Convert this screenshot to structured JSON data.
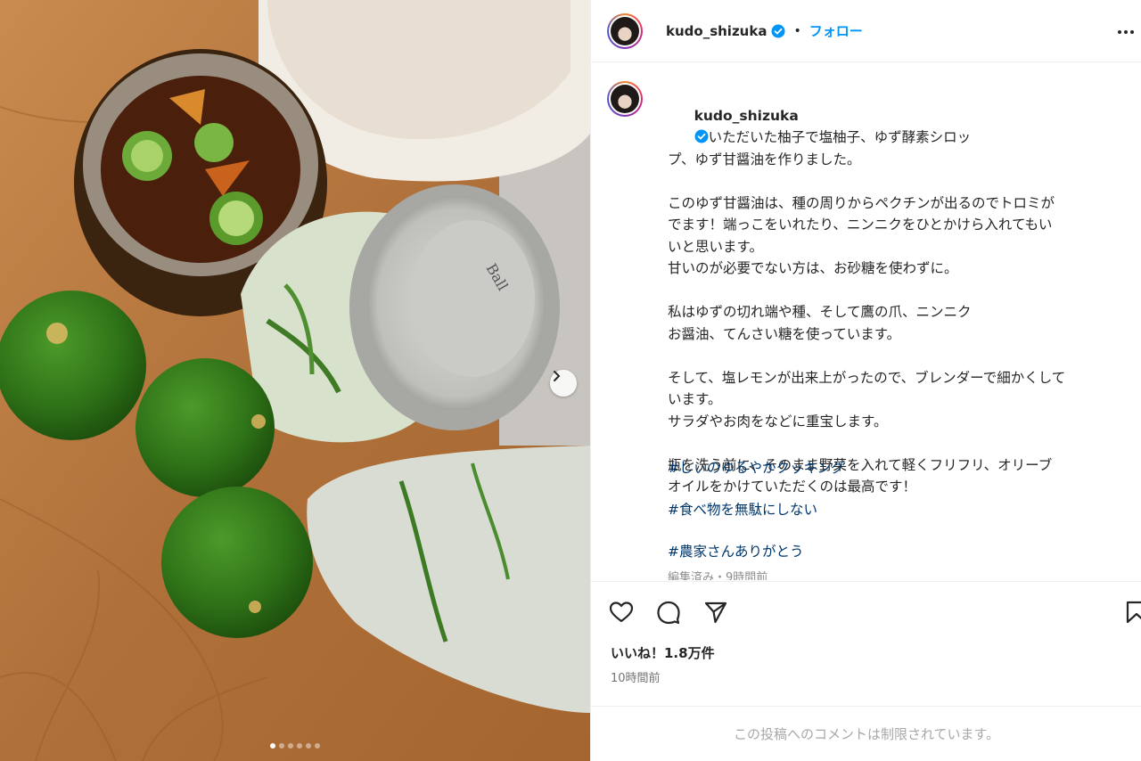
{
  "post": {
    "username": "kudo_shizuka",
    "verified_icon": "verified-badge-icon",
    "separator": "•",
    "follow_label": "フォロー",
    "caption_intro": "いただいた柚子で塩柚子、ゆず酵素シロッ\nプ、ゆず甘醤油を作りました。",
    "caption_body": "このゆず甘醤油は、種の周りからペクチンが出るのでトロミが\nでます！端っこをいれたり、ニンニクをひとかけら入れてもい\nいと思います。\n甘いのが必要でない方は、お砂糖を使わずに。\n\n私はゆずの切れ端や種、そして鷹の爪、ニンニク\nお醤油、てんさい糖を使っています。\n\nそして、塩レモンが出来上がったので、ブレンダーで細かくして\nいます。\nサラダやお肉をなどに重宝します。\n\n瓶を洗う前に、そのまま野菜を入れて軽くフリフリ、オリーブ\nオイルをかけていただくのは最高です！",
    "hashtags": [
      "#しぃのゆるやかクッキング",
      "#食べ物を無駄にしない",
      "#農家さんありがとう"
    ],
    "edited_time": "編集済み・9時間前",
    "likes": "いいね！1.8万件",
    "posted_time": "10時間前",
    "comments_disabled": "この投稿へのコメントは制限されています。"
  },
  "carousel": {
    "total": 6,
    "current": 1
  },
  "photo": {
    "lid_text": "Ball",
    "description_icons": [
      "next-arrow-icon"
    ]
  },
  "colors": {
    "accent": "#0095f6",
    "hashtag": "#00376b",
    "text": "#262626",
    "muted": "#8e8e8e"
  }
}
